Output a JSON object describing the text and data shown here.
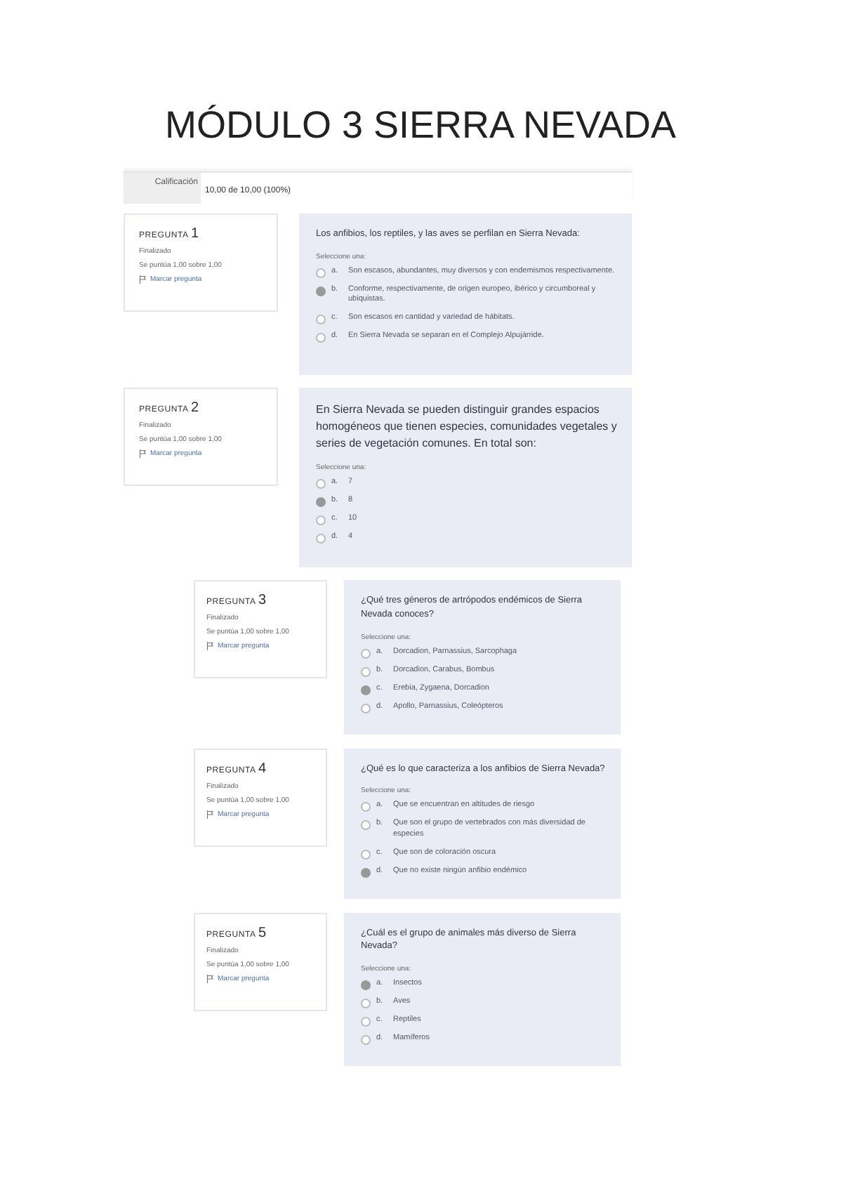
{
  "title": "MÓDULO 3 SIERRA NEVADA",
  "grade": {
    "label": "Calificación",
    "value": "10,00 de 10,00 (100%)"
  },
  "questions": [
    {
      "heading": "PREGUNTA",
      "number": "1",
      "status": "Finalizado",
      "score": "Se puntúa 1,00 sobre 1,00",
      "flag": "Marcar pregunta",
      "text": "Los anfibios, los reptiles, y las aves se perfilan en Sierra Nevada:",
      "prompt": "Seleccione una:",
      "options": [
        {
          "letter": "a.",
          "text": "Son escasos, abundantes, muy diversos y con endemismos respectivamente.",
          "selected": false
        },
        {
          "letter": "b.",
          "text": "Conforme, respectivamente, de origen europeo, ibérico y circumboreal y ubiquistas.",
          "selected": true
        },
        {
          "letter": "c.",
          "text": "Son escasos en cantidad y variedad de hábitats.",
          "selected": false
        },
        {
          "letter": "d.",
          "text": "En Sierra Nevada se separan en el Complejo Alpujárride.",
          "selected": false
        }
      ]
    },
    {
      "heading": "PREGUNTA",
      "number": "2",
      "status": "Finalizado",
      "score": "Se puntúa 1,00 sobre 1,00",
      "flag": "Marcar pregunta",
      "text": "En Sierra Nevada se pueden distinguir grandes espacios homogéneos que tienen especies, comunidades vegetales y series de vegetación comunes. En total son:",
      "prompt": "Seleccione una:",
      "options": [
        {
          "letter": "a.",
          "text": "7",
          "selected": false
        },
        {
          "letter": "b.",
          "text": "8",
          "selected": true
        },
        {
          "letter": "c.",
          "text": "10",
          "selected": false
        },
        {
          "letter": "d.",
          "text": "4",
          "selected": false
        }
      ]
    },
    {
      "heading": "PREGUNTA",
      "number": "3",
      "status": "Finalizado",
      "score": "Se puntúa 1,00 sobre 1,00",
      "flag": "Marcar pregunta",
      "text": "¿Qué tres géneros de artrópodos endémicos de Sierra Nevada conoces?",
      "prompt": "Seleccione una:",
      "options": [
        {
          "letter": "a.",
          "text": "Dorcadion, Parnassius, Sarcophaga",
          "selected": false
        },
        {
          "letter": "b.",
          "text": "Dorcadion, Carabus, Bombus",
          "selected": false
        },
        {
          "letter": "c.",
          "text": "Erebia, Zygaena, Dorcadion",
          "selected": true
        },
        {
          "letter": "d.",
          "text": "Apollo, Parnassius, Coleópteros",
          "selected": false
        }
      ]
    },
    {
      "heading": "PREGUNTA",
      "number": "4",
      "status": "Finalizado",
      "score": "Se puntúa 1,00 sobre 1,00",
      "flag": "Marcar pregunta",
      "text": "¿Qué es lo que caracteriza a los anfibios de Sierra Nevada?",
      "prompt": "Seleccione una:",
      "options": [
        {
          "letter": "a.",
          "text": "Que se encuentran en altitudes de riesgo",
          "selected": false
        },
        {
          "letter": "b.",
          "text": "Que son el grupo de vertebrados con más diversidad de especies",
          "selected": false
        },
        {
          "letter": "c.",
          "text": "Que son de coloración oscura",
          "selected": false
        },
        {
          "letter": "d.",
          "text": "Que no existe ningún anfibio endémico",
          "selected": true
        }
      ]
    },
    {
      "heading": "PREGUNTA",
      "number": "5",
      "status": "Finalizado",
      "score": "Se puntúa 1,00 sobre 1,00",
      "flag": "Marcar pregunta",
      "text": "¿Cuál es el grupo de animales más diverso de Sierra Nevada?",
      "prompt": "Seleccione una:",
      "options": [
        {
          "letter": "a.",
          "text": "Insectos",
          "selected": true
        },
        {
          "letter": "b.",
          "text": "Aves",
          "selected": false
        },
        {
          "letter": "c.",
          "text": "Reptiles",
          "selected": false
        },
        {
          "letter": "d.",
          "text": "Mamíferos",
          "selected": false
        }
      ]
    }
  ]
}
